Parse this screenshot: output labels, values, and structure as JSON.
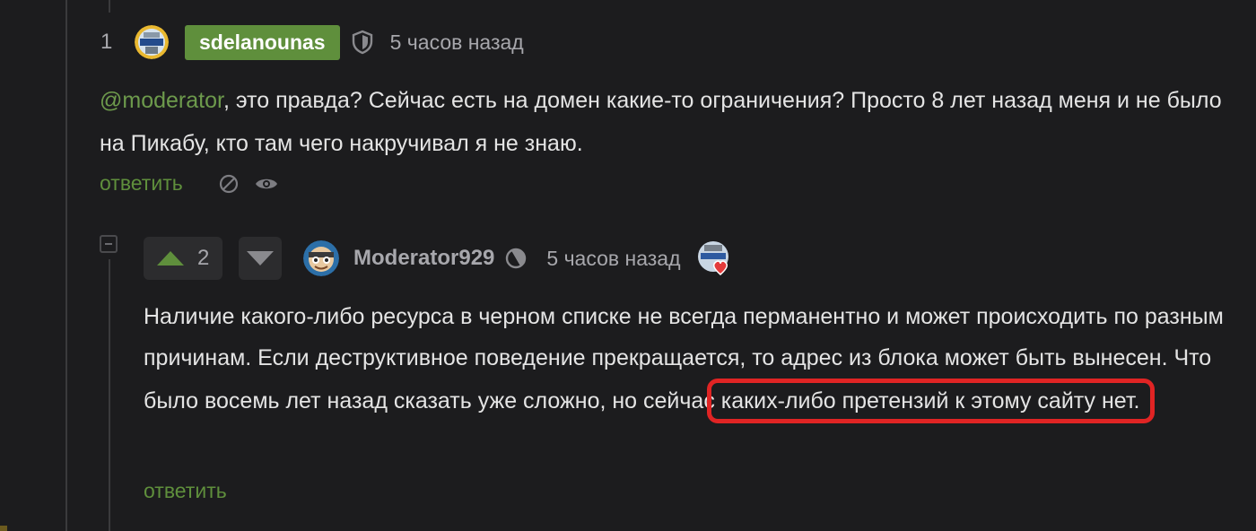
{
  "comment1": {
    "number": "1",
    "author": "sdelanounas",
    "time": "5 часов назад",
    "mention": "@moderator",
    "text": ", это правда? Сейчас есть на домен какие-то ограничения? Просто 8 лет назад меня и не было на Пикабу, кто там чего накручивал я не знаю.",
    "reply_label": "ответить",
    "icons": [
      "shield-icon",
      "block-icon",
      "eye-icon"
    ]
  },
  "comment2": {
    "votes": "2",
    "author": "Moderator929",
    "time": "5 часов назад",
    "text_main": "Наличие какого-либо ресурса в черном списке не всегда перманентно и может происходить по разным причинам. Если деструктивное поведение прекращается, то адрес из блока может быть вынесен. Что было восемь лет назад сказать уже сложно, но сейчас ",
    "text_highlighted": "каких-либо претензий к этому сайту нет.",
    "reply_label": "ответить",
    "icons": [
      "upvote-icon",
      "downvote-icon",
      "moderator-icon",
      "award-heart-icon"
    ]
  },
  "colors": {
    "background": "#1c1c1e",
    "accent_green": "#5f8f3c",
    "highlight_red": "#e02424",
    "muted_text": "#a7a7ac"
  }
}
